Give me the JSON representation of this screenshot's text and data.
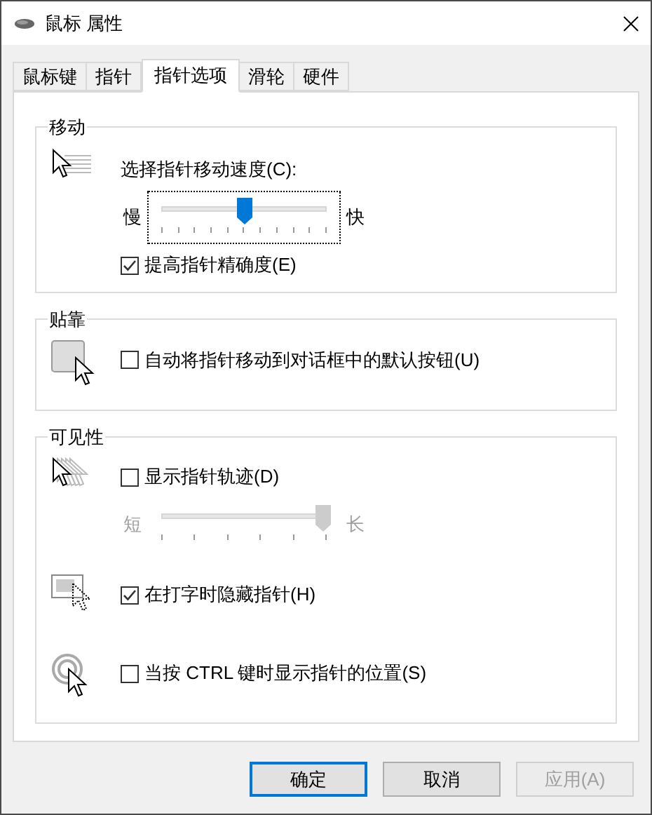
{
  "window": {
    "title": "鼠标 属性"
  },
  "tabs": [
    {
      "label": "鼠标键",
      "selected": false
    },
    {
      "label": "指针",
      "selected": false
    },
    {
      "label": "指针选项",
      "selected": true
    },
    {
      "label": "滑轮",
      "selected": false
    },
    {
      "label": "硬件",
      "selected": false
    }
  ],
  "groups": [
    {
      "title": "移动",
      "rows": [
        {
          "items": [
            {
              "kind": "label",
              "text": "选择指针移动速度(C):"
            },
            {
              "kind": "slider",
              "min_label": "慢",
              "max_label": "快",
              "level": 0.5,
              "disabled": false,
              "focused": true
            },
            {
              "kind": "checkbox",
              "label": "提高指针精确度(E)",
              "checked": true
            }
          ]
        }
      ]
    },
    {
      "title": "贴靠",
      "rows": [
        {
          "items": [
            {
              "kind": "checkbox",
              "label": "自动将指针移动到对话框中的默认按钮(U)",
              "checked": false
            }
          ]
        }
      ]
    },
    {
      "title": "可见性",
      "rows": [
        {
          "items": [
            {
              "kind": "checkbox",
              "label": "显示指针轨迹(D)",
              "checked": false
            },
            {
              "kind": "slider",
              "min_label": "短",
              "max_label": "长",
              "level": 1,
              "disabled": true,
              "focused": false
            }
          ]
        },
        {
          "items": [
            {
              "kind": "checkbox",
              "label": "在打字时隐藏指针(H)",
              "checked": true
            }
          ]
        },
        {
          "items": [
            {
              "kind": "checkbox",
              "label": "当按 CTRL 键时显示指针的位置(S)",
              "checked": false
            }
          ]
        }
      ]
    }
  ],
  "buttons": [
    {
      "label": "确定",
      "default": true,
      "disabled": false
    },
    {
      "label": "取消",
      "default": false,
      "disabled": false
    },
    {
      "label": "应用(A)",
      "default": false,
      "disabled": true
    }
  ]
}
